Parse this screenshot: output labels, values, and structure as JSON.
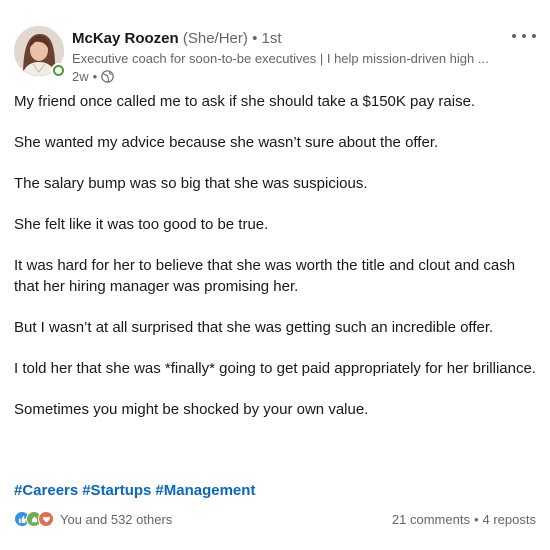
{
  "post": {
    "author": {
      "name": "McKay Roozen",
      "pronouns": "(She/Her)",
      "separator": "•",
      "degree": "1st",
      "headline": "Executive coach for soon-to-be executives | I help mission-driven high ...",
      "time": "2w",
      "time_separator": "•",
      "visibility_icon": "globe-icon",
      "status_color": "#4e9a3c"
    },
    "paragraphs": [
      "My friend once called me to ask if she should take a $150K pay raise.",
      "She wanted my advice because she wasn’t sure about the offer.",
      "The salary bump was so big that she was suspicious.",
      "She felt like it was too good to be true.",
      "It was hard for her to believe that she was worth the title and clout and cash that her hiring manager was promising her.",
      "But I wasn’t at all surprised that she was getting such an incredible offer.",
      "I told her that she was *finally* going to get paid appropriately for her brilliance.",
      "Sometimes you might be shocked by your own value."
    ],
    "hashtags": [
      "#Careers",
      "#Startups",
      "#Management"
    ],
    "social": {
      "reactions_text": "You and 532 others",
      "reaction_icons": [
        "like-icon",
        "celebrate-icon",
        "support-icon"
      ],
      "comments": "21 comments",
      "stats_separator": "•",
      "reposts": "4 reposts"
    },
    "colors": {
      "link": "#0a66c2",
      "text": "#191919",
      "muted": "#666666"
    }
  }
}
